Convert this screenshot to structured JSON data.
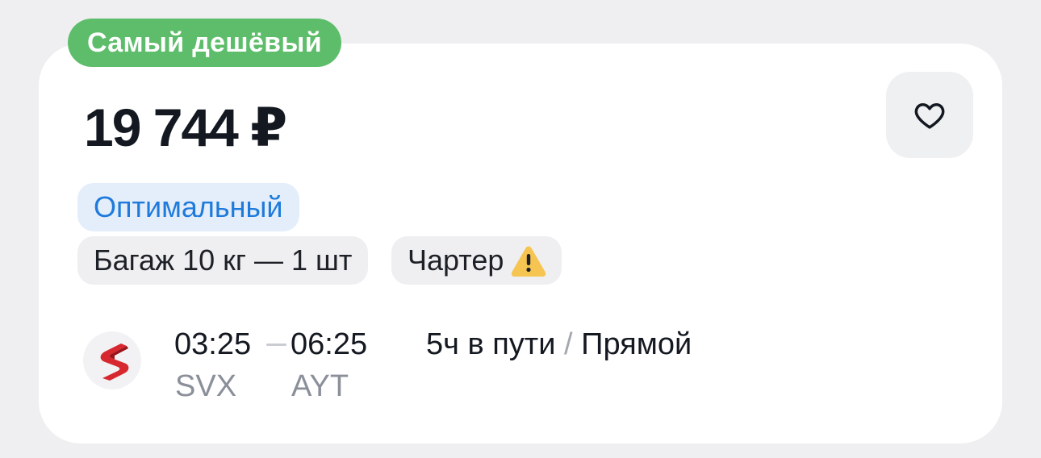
{
  "badge": {
    "label": "Самый дешёвый",
    "color": "#5dbd6a"
  },
  "price": {
    "value": "19 744 ₽"
  },
  "favorite": {
    "icon": "heart-outline-icon"
  },
  "tags": {
    "tariff": "Оптимальный",
    "baggage": "Багаж 10 кг — 1 шт",
    "charter": "Чартер",
    "charter_icon": "warning-icon"
  },
  "flight": {
    "airline_logo": "airline-s-logo",
    "departure_time": "03:25",
    "arrival_time": "06:25",
    "departure_code": "SVX",
    "arrival_code": "AYT",
    "duration": "5ч в пути",
    "separator": "/",
    "stops": "Прямой"
  },
  "colors": {
    "accent_blue": "#1e7bdb",
    "badge_green": "#5dbd6a",
    "warning_yellow": "#f5c451",
    "logo_red": "#d7282f"
  }
}
